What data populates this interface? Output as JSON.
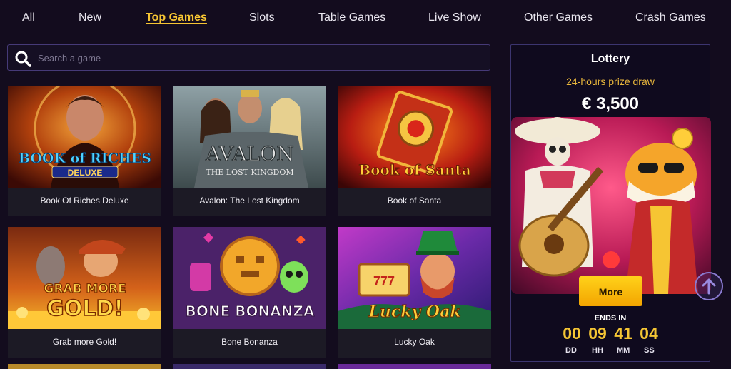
{
  "tabs": [
    {
      "label": "All"
    },
    {
      "label": "New"
    },
    {
      "label": "Top Games",
      "active": true
    },
    {
      "label": "Slots"
    },
    {
      "label": "Table Games"
    },
    {
      "label": "Live Show"
    },
    {
      "label": "Other Games"
    },
    {
      "label": "Crash Games"
    }
  ],
  "search": {
    "placeholder": "Search a game",
    "icon": "search-icon"
  },
  "games": [
    {
      "title": "Book Of Riches Deluxe",
      "art_text": "BOOK of RICHES",
      "art_sub": "DELUXE"
    },
    {
      "title": "Avalon: The Lost Kingdom",
      "art_text": "AVALON",
      "art_sub": "THE LOST KINGDOM"
    },
    {
      "title": "Book of Santa",
      "art_text": "Book of Santa"
    },
    {
      "title": "Grab more Gold!",
      "art_text": "GRAB MORE",
      "art_sub": "GOLD!"
    },
    {
      "title": "Bone Bonanza",
      "art_text": "BONE BONANZA"
    },
    {
      "title": "Lucky Oak",
      "art_text": "Lucky Oak"
    }
  ],
  "lottery": {
    "title": "Lottery",
    "subtitle": "24-hours prize draw",
    "amount": "€ 3,500",
    "button": "More",
    "ends_label": "ENDS IN",
    "timer": {
      "dd": "00",
      "hh": "09",
      "mm": "41",
      "ss": "04"
    },
    "units": {
      "dd": "DD",
      "hh": "HH",
      "mm": "MM",
      "ss": "SS"
    }
  },
  "colors": {
    "accent": "#f6c533",
    "background": "#130c1e",
    "card": "#1c1a25",
    "border": "#3c3570"
  }
}
